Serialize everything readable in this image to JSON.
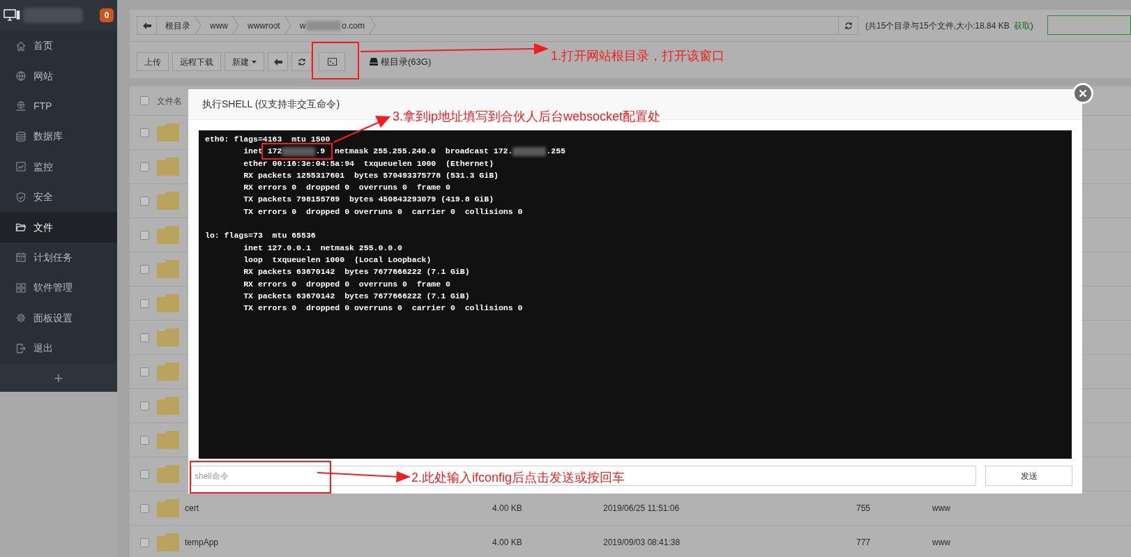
{
  "sidebar": {
    "badge": "0",
    "items": [
      {
        "label": "首页",
        "selected": false
      },
      {
        "label": "网站",
        "selected": false
      },
      {
        "label": "FTP",
        "selected": false
      },
      {
        "label": "数据库",
        "selected": false
      },
      {
        "label": "监控",
        "selected": false
      },
      {
        "label": "安全",
        "selected": false
      },
      {
        "label": "文件",
        "selected": true
      },
      {
        "label": "计划任务",
        "selected": false
      },
      {
        "label": "软件管理",
        "selected": false
      },
      {
        "label": "面板设置",
        "selected": false
      },
      {
        "label": "退出",
        "selected": false
      }
    ],
    "add_button": "+"
  },
  "breadcrumb": {
    "crumbs": [
      {
        "label": "根目录"
      },
      {
        "label": "www"
      },
      {
        "label": "wwwroot"
      },
      {
        "label": "w",
        "label_after": "o.com",
        "redacted": true
      }
    ]
  },
  "summary": {
    "text": "(共15个目录与15个文件,大小:18.84 KB",
    "link": "获取",
    "close": ")"
  },
  "toolbar": {
    "buttons": [
      {
        "kind": "text",
        "label": "上传"
      },
      {
        "kind": "text",
        "label": "远程下载"
      },
      {
        "kind": "dropdown",
        "label": "新建"
      },
      {
        "kind": "back"
      },
      {
        "kind": "refresh"
      },
      {
        "kind": "terminal"
      }
    ],
    "disk": "根目录(63G)"
  },
  "table": {
    "select_all": {
      "checked": false
    },
    "columns": [
      "文件名"
    ],
    "rows": [
      {
        "kind": "covered",
        "checked": false
      },
      {
        "kind": "covered",
        "checked": false
      },
      {
        "kind": "covered",
        "checked": false
      },
      {
        "kind": "covered",
        "checked": false
      },
      {
        "kind": "covered",
        "checked": false
      },
      {
        "kind": "covered",
        "checked": false
      },
      {
        "kind": "covered",
        "checked": false
      },
      {
        "kind": "covered",
        "checked": false
      },
      {
        "kind": "covered",
        "checked": false
      },
      {
        "kind": "covered",
        "checked": false
      },
      {
        "kind": "covered",
        "checked": false
      },
      {
        "kind": "file",
        "checked": false,
        "name": "cert",
        "size": "4.00 KB",
        "modified": "2019/06/25 11:51:06",
        "permission": "755",
        "owner": "www"
      },
      {
        "kind": "file",
        "checked": false,
        "name": "tempApp",
        "size": "4.00 KB",
        "modified": "2019/09/03 08:41:38",
        "permission": "777",
        "owner": "www"
      }
    ]
  },
  "dialog": {
    "title": "执行SHELL (仅支持非交互命令)",
    "terminal_lines": [
      {
        "kind": "text",
        "text": "eth0: flags=4163  mtu 1500"
      },
      {
        "kind": "redacted",
        "parts": [
          "        inet 172",
          ".9  netmask 255.255.240.0  broadcast 172.",
          ".255"
        ]
      },
      {
        "kind": "text",
        "text": "        ether 00:16:3e:04:5a:94  txqueuelen 1000  (Ethernet)"
      },
      {
        "kind": "text",
        "text": "        RX packets 1255317601  bytes 570493375778 (531.3 GiB)"
      },
      {
        "kind": "text",
        "text": "        RX errors 0  dropped 0  overruns 0  frame 0"
      },
      {
        "kind": "text",
        "text": "        TX packets 798155789  bytes 450843293079 (419.8 GiB)"
      },
      {
        "kind": "text",
        "text": "        TX errors 0  dropped 0 overruns 0  carrier 0  collisions 0"
      },
      {
        "kind": "blank"
      },
      {
        "kind": "text",
        "text": "lo: flags=73  mtu 65536"
      },
      {
        "kind": "text",
        "text": "        inet 127.0.0.1  netmask 255.0.0.0"
      },
      {
        "kind": "text",
        "text": "        loop  txqueuelen 1000  (Local Loopback)"
      },
      {
        "kind": "text",
        "text": "        RX packets 63670142  bytes 7677666222 (7.1 GiB)"
      },
      {
        "kind": "text",
        "text": "        RX errors 0  dropped 0  overruns 0  frame 0"
      },
      {
        "kind": "text",
        "text": "        TX packets 63670142  bytes 7677666222 (7.1 GiB)"
      },
      {
        "kind": "text",
        "text": "        TX errors 0  dropped 0 overruns 0  carrier 0  collisions 0"
      }
    ],
    "input": {
      "placeholder": "shell命令"
    },
    "send_button": "发送"
  },
  "annotations": [
    {
      "text": "1.打开网站根目录，打开该窗口"
    },
    {
      "text": "3.拿到ip地址填写到合伙人后台websocket配置处"
    },
    {
      "text": "2.此处输入ifconfig后点击发送或按回车"
    }
  ]
}
